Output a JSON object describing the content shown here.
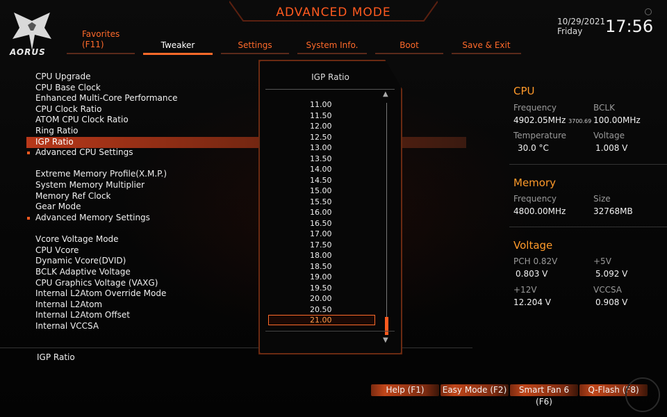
{
  "header": {
    "title": "ADVANCED MODE",
    "logo_text": "AORUS",
    "date": "10/29/2021",
    "day": "Friday",
    "time": "17:56"
  },
  "tabs": [
    {
      "label": "Favorites",
      "sub": "(F11)"
    },
    {
      "label": "Tweaker"
    },
    {
      "label": "Settings"
    },
    {
      "label": "System Info."
    },
    {
      "label": "Boot"
    },
    {
      "label": "Save & Exit"
    }
  ],
  "active_tab": "Tweaker",
  "menu": {
    "items": [
      "CPU Upgrade",
      "CPU Base Clock",
      "Enhanced Multi-Core Performance",
      "CPU Clock Ratio",
      "ATOM CPU Clock Ratio",
      "Ring Ratio",
      "IGP Ratio",
      "Advanced CPU Settings",
      "Extreme Memory Profile(X.M.P.)",
      "System Memory Multiplier",
      "Memory Ref Clock",
      "Gear Mode",
      "Advanced Memory Settings",
      "Vcore Voltage Mode",
      "CPU Vcore",
      "Dynamic Vcore(DVID)",
      "BCLK Adaptive Voltage",
      "CPU Graphics Voltage (VAXG)",
      "Internal L2Atom Override Mode",
      "Internal L2Atom",
      "Internal L2Atom Offset",
      "Internal VCCSA"
    ],
    "selected": "IGP Ratio"
  },
  "help_text": "IGP Ratio",
  "popup": {
    "title": "IGP Ratio",
    "options": [
      "11.00",
      "11.50",
      "12.00",
      "12.50",
      "13.00",
      "13.50",
      "14.00",
      "14.50",
      "15.00",
      "15.50",
      "16.00",
      "16.50",
      "17.00",
      "17.50",
      "18.00",
      "18.50",
      "19.00",
      "19.50",
      "20.00",
      "20.50",
      "21.00"
    ],
    "selected": "21.00"
  },
  "cpu": {
    "title": "CPU",
    "frequency_label": "Frequency",
    "frequency_value": "4902.05MHz",
    "frequency_sub": "3700.69",
    "bclk_label": "BCLK",
    "bclk_value": "100.00MHz",
    "temperature_label": "Temperature",
    "temperature_value": "30.0 °C",
    "voltage_label": "Voltage",
    "voltage_value": "1.008 V"
  },
  "memory": {
    "title": "Memory",
    "frequency_label": "Frequency",
    "frequency_value": "4800.00MHz",
    "size_label": "Size",
    "size_value": "32768MB"
  },
  "voltage": {
    "title": "Voltage",
    "pch_label": "PCH 0.82V",
    "pch_value": "0.803 V",
    "v5_label": "+5V",
    "v5_value": "5.092 V",
    "v12_label": "+12V",
    "v12_value": "12.204 V",
    "vccsa_label": "VCCSA",
    "vccsa_value": "0.908 V"
  },
  "function_buttons": [
    {
      "label": "Help (F1)"
    },
    {
      "label": "Easy Mode (F2)"
    },
    {
      "label": "Smart Fan 6 (F6)"
    },
    {
      "label": "Q-Flash (F8)"
    }
  ],
  "colors": {
    "accent": "#ff5a1f",
    "section_title": "#ff9a2a",
    "selected_bar": "#b8381a"
  }
}
